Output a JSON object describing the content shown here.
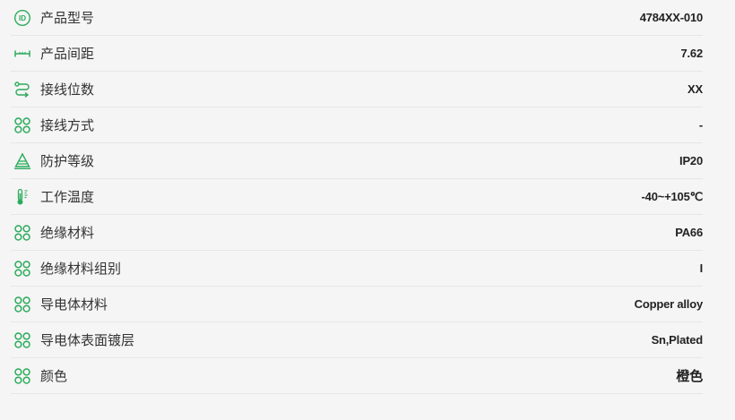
{
  "accent_color": "#2bab5b",
  "specs": [
    {
      "icon": "id-icon",
      "label": "产品型号",
      "value": "4784XX-010"
    },
    {
      "icon": "pitch-measure-icon",
      "label": "产品间距",
      "value": "7.62"
    },
    {
      "icon": "wire-route-icon",
      "label": "接线位数",
      "value": "XX"
    },
    {
      "icon": "clover-icon",
      "label": "接线方式",
      "value": "-"
    },
    {
      "icon": "protection-cone-icon",
      "label": "防护等级",
      "value": "IP20"
    },
    {
      "icon": "thermometer-icon",
      "label": "工作温度",
      "value": "-40~+105℃"
    },
    {
      "icon": "clover-icon",
      "label": "绝缘材料",
      "value": "PA66"
    },
    {
      "icon": "clover-icon",
      "label": "绝缘材料组别",
      "value": "I"
    },
    {
      "icon": "clover-icon",
      "label": "导电体材料",
      "value": "Copper alloy"
    },
    {
      "icon": "clover-icon",
      "label": "导电体表面镀层",
      "value": "Sn,Plated"
    },
    {
      "icon": "clover-icon",
      "label": "颜色",
      "value": "橙色"
    }
  ]
}
